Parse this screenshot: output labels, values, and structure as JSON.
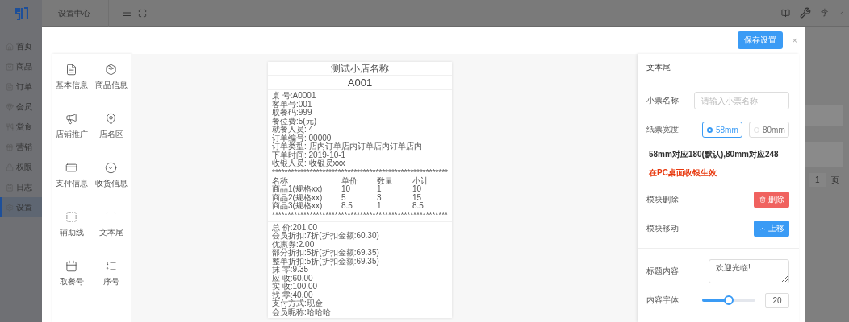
{
  "topbar": {
    "title": "设置中心",
    "user": "李"
  },
  "sidebar": {
    "items": [
      {
        "label": "首页",
        "selected": false
      },
      {
        "label": "商品",
        "selected": false
      },
      {
        "label": "订单",
        "selected": false
      },
      {
        "label": "会员",
        "selected": false
      },
      {
        "label": "堂食",
        "selected": false
      },
      {
        "label": "营销",
        "selected": false
      },
      {
        "label": "权限",
        "selected": false
      },
      {
        "label": "日志",
        "selected": false
      },
      {
        "label": "设置",
        "selected": true
      }
    ]
  },
  "background_page": {
    "pagination": {
      "page": "1",
      "unit": "页"
    }
  },
  "modal": {
    "save_button": "保存设置",
    "close": "×"
  },
  "components": [
    {
      "label": "基本信息"
    },
    {
      "label": "商品信息"
    },
    {
      "label": "店铺推广"
    },
    {
      "label": "店名区"
    },
    {
      "label": "支付信息"
    },
    {
      "label": "收货信息"
    },
    {
      "label": "辅助线"
    },
    {
      "label": "文本尾"
    },
    {
      "label": "取餐号"
    },
    {
      "label": "序号"
    }
  ],
  "receipt": {
    "title": "测试小店名称",
    "code": "A001",
    "info_lines": [
      "桌 号:A0001",
      "客单号:001",
      "取餐码:999",
      "餐位费:5(元)",
      "就餐人员: 4",
      "订单编号: 00000",
      "订单类型: 店内订单店内订单店内订单店内",
      "下单时间: 2019-10-1",
      "收银人员: 收银员xxx"
    ],
    "divider": "********************************************************",
    "columns": [
      "名称",
      "单价",
      "数量",
      "小计"
    ],
    "rows": [
      [
        "商品1(规格xx)",
        "10",
        "1",
        "10"
      ],
      [
        "商品2(规格xx)",
        "5",
        "3",
        "15"
      ],
      [
        "商品3(规格xx)",
        "8.5",
        "1",
        "8.5"
      ]
    ],
    "divider_bottom": "********************************************************",
    "totals": [
      "总 价:201.00",
      "会员折扣:7折(折扣金额:60.30)",
      "优惠券:2.00",
      "部分折扣:5折(折扣金额:69.35)",
      "整单折扣:5折(折扣金额:69.35)",
      "抹 零:9.35",
      "应 收:60.00",
      "实 收:100.00",
      "找 零:40.00",
      "支付方式:现金",
      "会员昵称:哈哈哈"
    ]
  },
  "settings": {
    "title": "文本尾",
    "rows": [
      {
        "kind": "input",
        "label": "小票名称",
        "placeholder": "请输入小票名称"
      },
      {
        "kind": "radio",
        "label": "纸票宽度",
        "options": [
          {
            "label": "58mm",
            "selected": true
          },
          {
            "label": "80mm",
            "selected": false
          }
        ]
      },
      {
        "kind": "note",
        "text": "58mm对应180(默认),80mm对应248",
        "warning": "在PC桌面收银生效"
      },
      {
        "kind": "delete",
        "label": "模块删除",
        "button": "删除"
      },
      {
        "kind": "move",
        "label": "模块移动",
        "button": "上移"
      },
      {
        "kind": "divider"
      },
      {
        "kind": "textarea",
        "label": "标题内容",
        "value": "欢迎光临!"
      },
      {
        "kind": "slider",
        "label": "内容字体",
        "level": 0.5,
        "value": "20"
      }
    ]
  }
}
